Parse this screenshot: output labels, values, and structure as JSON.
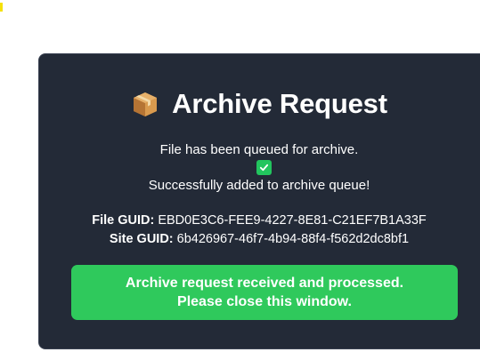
{
  "dialog": {
    "title": "Archive Request",
    "title_icon": "package-box-icon",
    "queued_message": "File has been queued for archive.",
    "status_icon": "check-mark-icon",
    "success_message": "Successfully added to archive queue!",
    "file_guid": {
      "label": "File GUID:",
      "value": "EBD0E3C6-FEE9-4227-8E81-C21EF7B1A33F"
    },
    "site_guid": {
      "label": "Site GUID:",
      "value": "6b426967-46f7-4b94-88f4-f562d2dc8bf1"
    },
    "banner": {
      "line1": "Archive request received and processed.",
      "line2": "Please close this window."
    }
  },
  "colors": {
    "dialog_background": "#232a37",
    "banner_green": "#2fc95c",
    "check_green": "#22c55e",
    "corner_mark": "#f5e10a"
  }
}
